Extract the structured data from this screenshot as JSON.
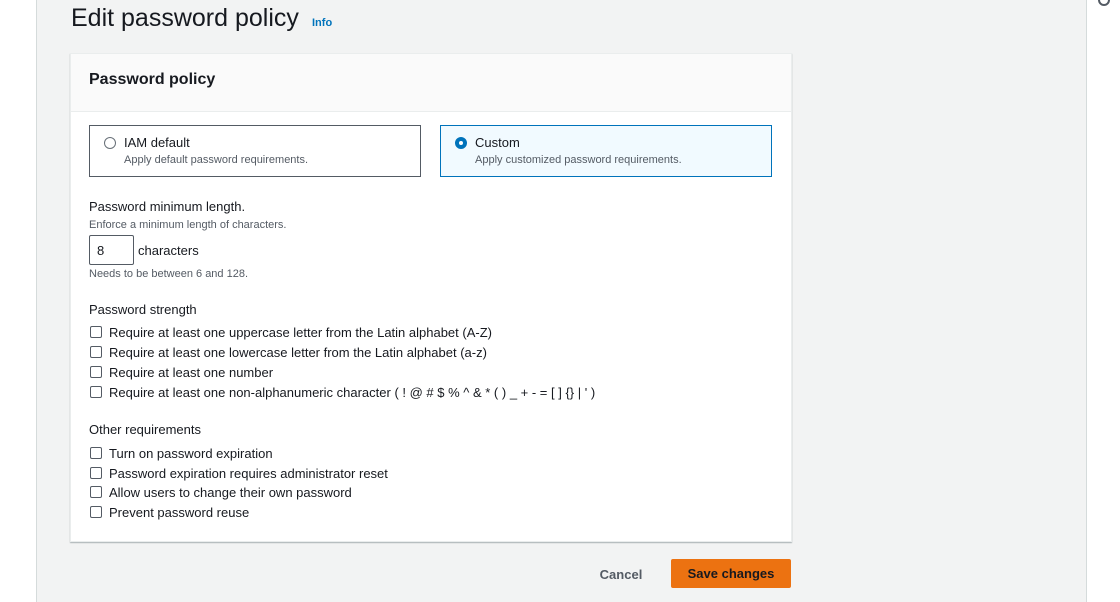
{
  "header": {
    "title": "Edit password policy",
    "info_label": "Info"
  },
  "panel": {
    "title": "Password policy",
    "tiles": [
      {
        "label": "IAM default",
        "description": "Apply default password requirements.",
        "selected": false
      },
      {
        "label": "Custom",
        "description": "Apply customized password requirements.",
        "selected": true
      }
    ],
    "min_length": {
      "label": "Password minimum length.",
      "description": "Enforce a minimum length of characters.",
      "value": "8",
      "unit": "characters",
      "hint": "Needs to be between 6 and 128."
    },
    "strength": {
      "heading": "Password strength",
      "options": [
        {
          "label": "Require at least one uppercase letter from the Latin alphabet (A-Z)",
          "checked": false
        },
        {
          "label": "Require at least one lowercase letter from the Latin alphabet (a-z)",
          "checked": false
        },
        {
          "label": "Require at least one number",
          "checked": false
        },
        {
          "label": "Require at least one non-alphanumeric character ( ! @ # $ % ^ & * ( ) _ + - = [ ] {} | ' )",
          "checked": false
        }
      ]
    },
    "other": {
      "heading": "Other requirements",
      "options": [
        {
          "label": "Turn on password expiration",
          "checked": false
        },
        {
          "label": "Password expiration requires administrator reset",
          "checked": false
        },
        {
          "label": "Allow users to change their own password",
          "checked": false
        },
        {
          "label": "Prevent password reuse",
          "checked": false
        }
      ]
    }
  },
  "actions": {
    "cancel_label": "Cancel",
    "save_label": "Save changes"
  },
  "colors": {
    "accent": "#0073bb",
    "primary_button": "#ec7211",
    "background": "#f2f3f3"
  },
  "icons": {
    "corner": "help-icon"
  }
}
